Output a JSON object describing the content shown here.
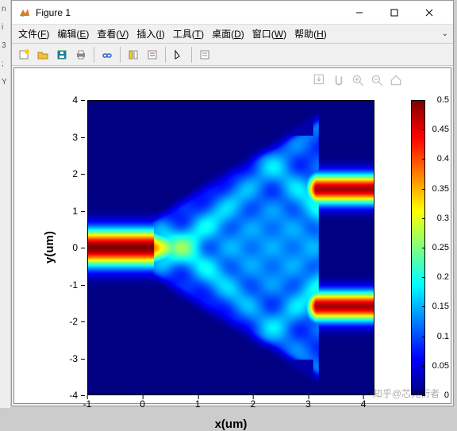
{
  "window": {
    "title": "Figure 1"
  },
  "menubar": {
    "items": [
      {
        "label": "文件",
        "key": "F"
      },
      {
        "label": "编辑",
        "key": "E"
      },
      {
        "label": "查看",
        "key": "V"
      },
      {
        "label": "插入",
        "key": "I"
      },
      {
        "label": "工具",
        "key": "T"
      },
      {
        "label": "桌面",
        "key": "D"
      },
      {
        "label": "窗口",
        "key": "W"
      },
      {
        "label": "帮助",
        "key": "H"
      }
    ]
  },
  "toolbar": {
    "icons": [
      "new-figure",
      "open",
      "save",
      "print",
      "sep",
      "link",
      "sep",
      "rotate",
      "sep",
      "cursor",
      "sep",
      "arrow",
      "insert"
    ]
  },
  "axes_toolbar": {
    "icons": [
      "export",
      "pan",
      "zoom-in",
      "zoom-out",
      "home"
    ]
  },
  "chart_data": {
    "type": "heatmap",
    "title": "",
    "xlabel": "x(um)",
    "ylabel": "y(um)",
    "xlim": [
      -1,
      4.2
    ],
    "ylim": [
      -4,
      4
    ],
    "xticks": [
      -1,
      0,
      1,
      2,
      3,
      4
    ],
    "yticks": [
      -4,
      -3,
      -2,
      -1,
      0,
      1,
      2,
      3,
      4
    ],
    "colorbar": {
      "min": 0,
      "max": 0.5,
      "ticks": [
        0,
        0.05,
        0.1,
        0.15,
        0.2,
        0.25,
        0.3,
        0.35,
        0.4,
        0.45,
        0.5
      ],
      "colormap": "jet"
    },
    "description": "Electromagnetic field intensity through a waveguide Y-splitter. Input single waveguide near y=0 for x<0 (intensity ~0.5), tapered diffraction region 0<x<3 with interference fringes (intensity 0.1–0.3), output splits into two waveguides at y≈+1.6 and y≈-1.6 for x>3 (intensity ~0.4–0.5). Background ~0.",
    "nx": 104,
    "ny": 160
  },
  "watermark": "知乎@芯光衍者"
}
